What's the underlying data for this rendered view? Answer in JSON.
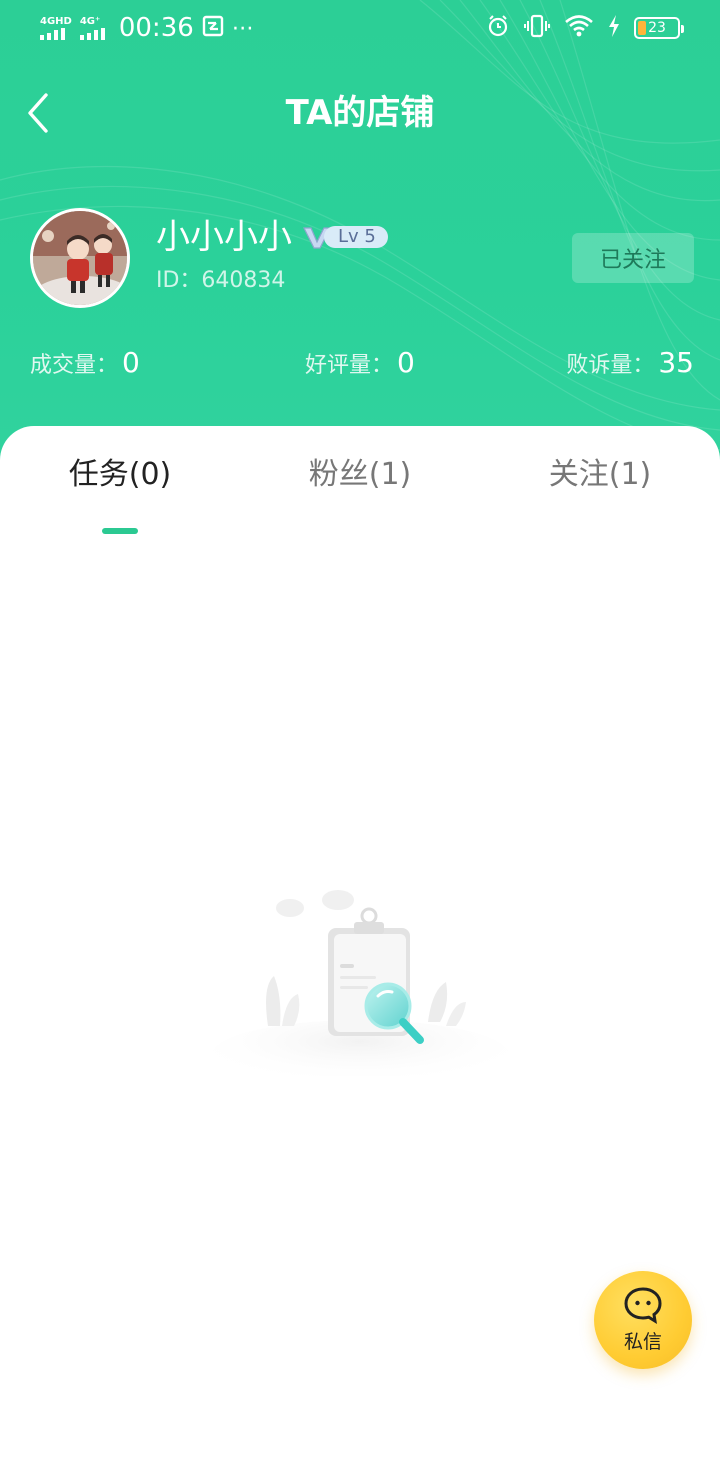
{
  "status_bar": {
    "signal1_label": "4GHD",
    "signal2_label": "4G⁺",
    "time": "00:36",
    "extra": "⋯",
    "battery": "23"
  },
  "nav": {
    "title": "TA的店铺",
    "back_icon": "chevron-left-icon"
  },
  "profile": {
    "name": "小小小小",
    "level": "Lv 5",
    "id": "ID：640834",
    "follow_label": "已关注"
  },
  "stats": [
    {
      "label": "成交量：",
      "value": "0"
    },
    {
      "label": "好评量：",
      "value": "0"
    },
    {
      "label": "败诉量：",
      "value": "35"
    }
  ],
  "tabs": [
    {
      "label": "任务(0)",
      "active": true
    },
    {
      "label": "粉丝(1)",
      "active": false
    },
    {
      "label": "关注(1)",
      "active": false
    }
  ],
  "fab": {
    "label": "私信",
    "icon": "chat-bubble-icon"
  },
  "colors": {
    "brand": "#2bd19a",
    "tab_indicator": "#2bc992",
    "fab": "#ffcc33"
  }
}
